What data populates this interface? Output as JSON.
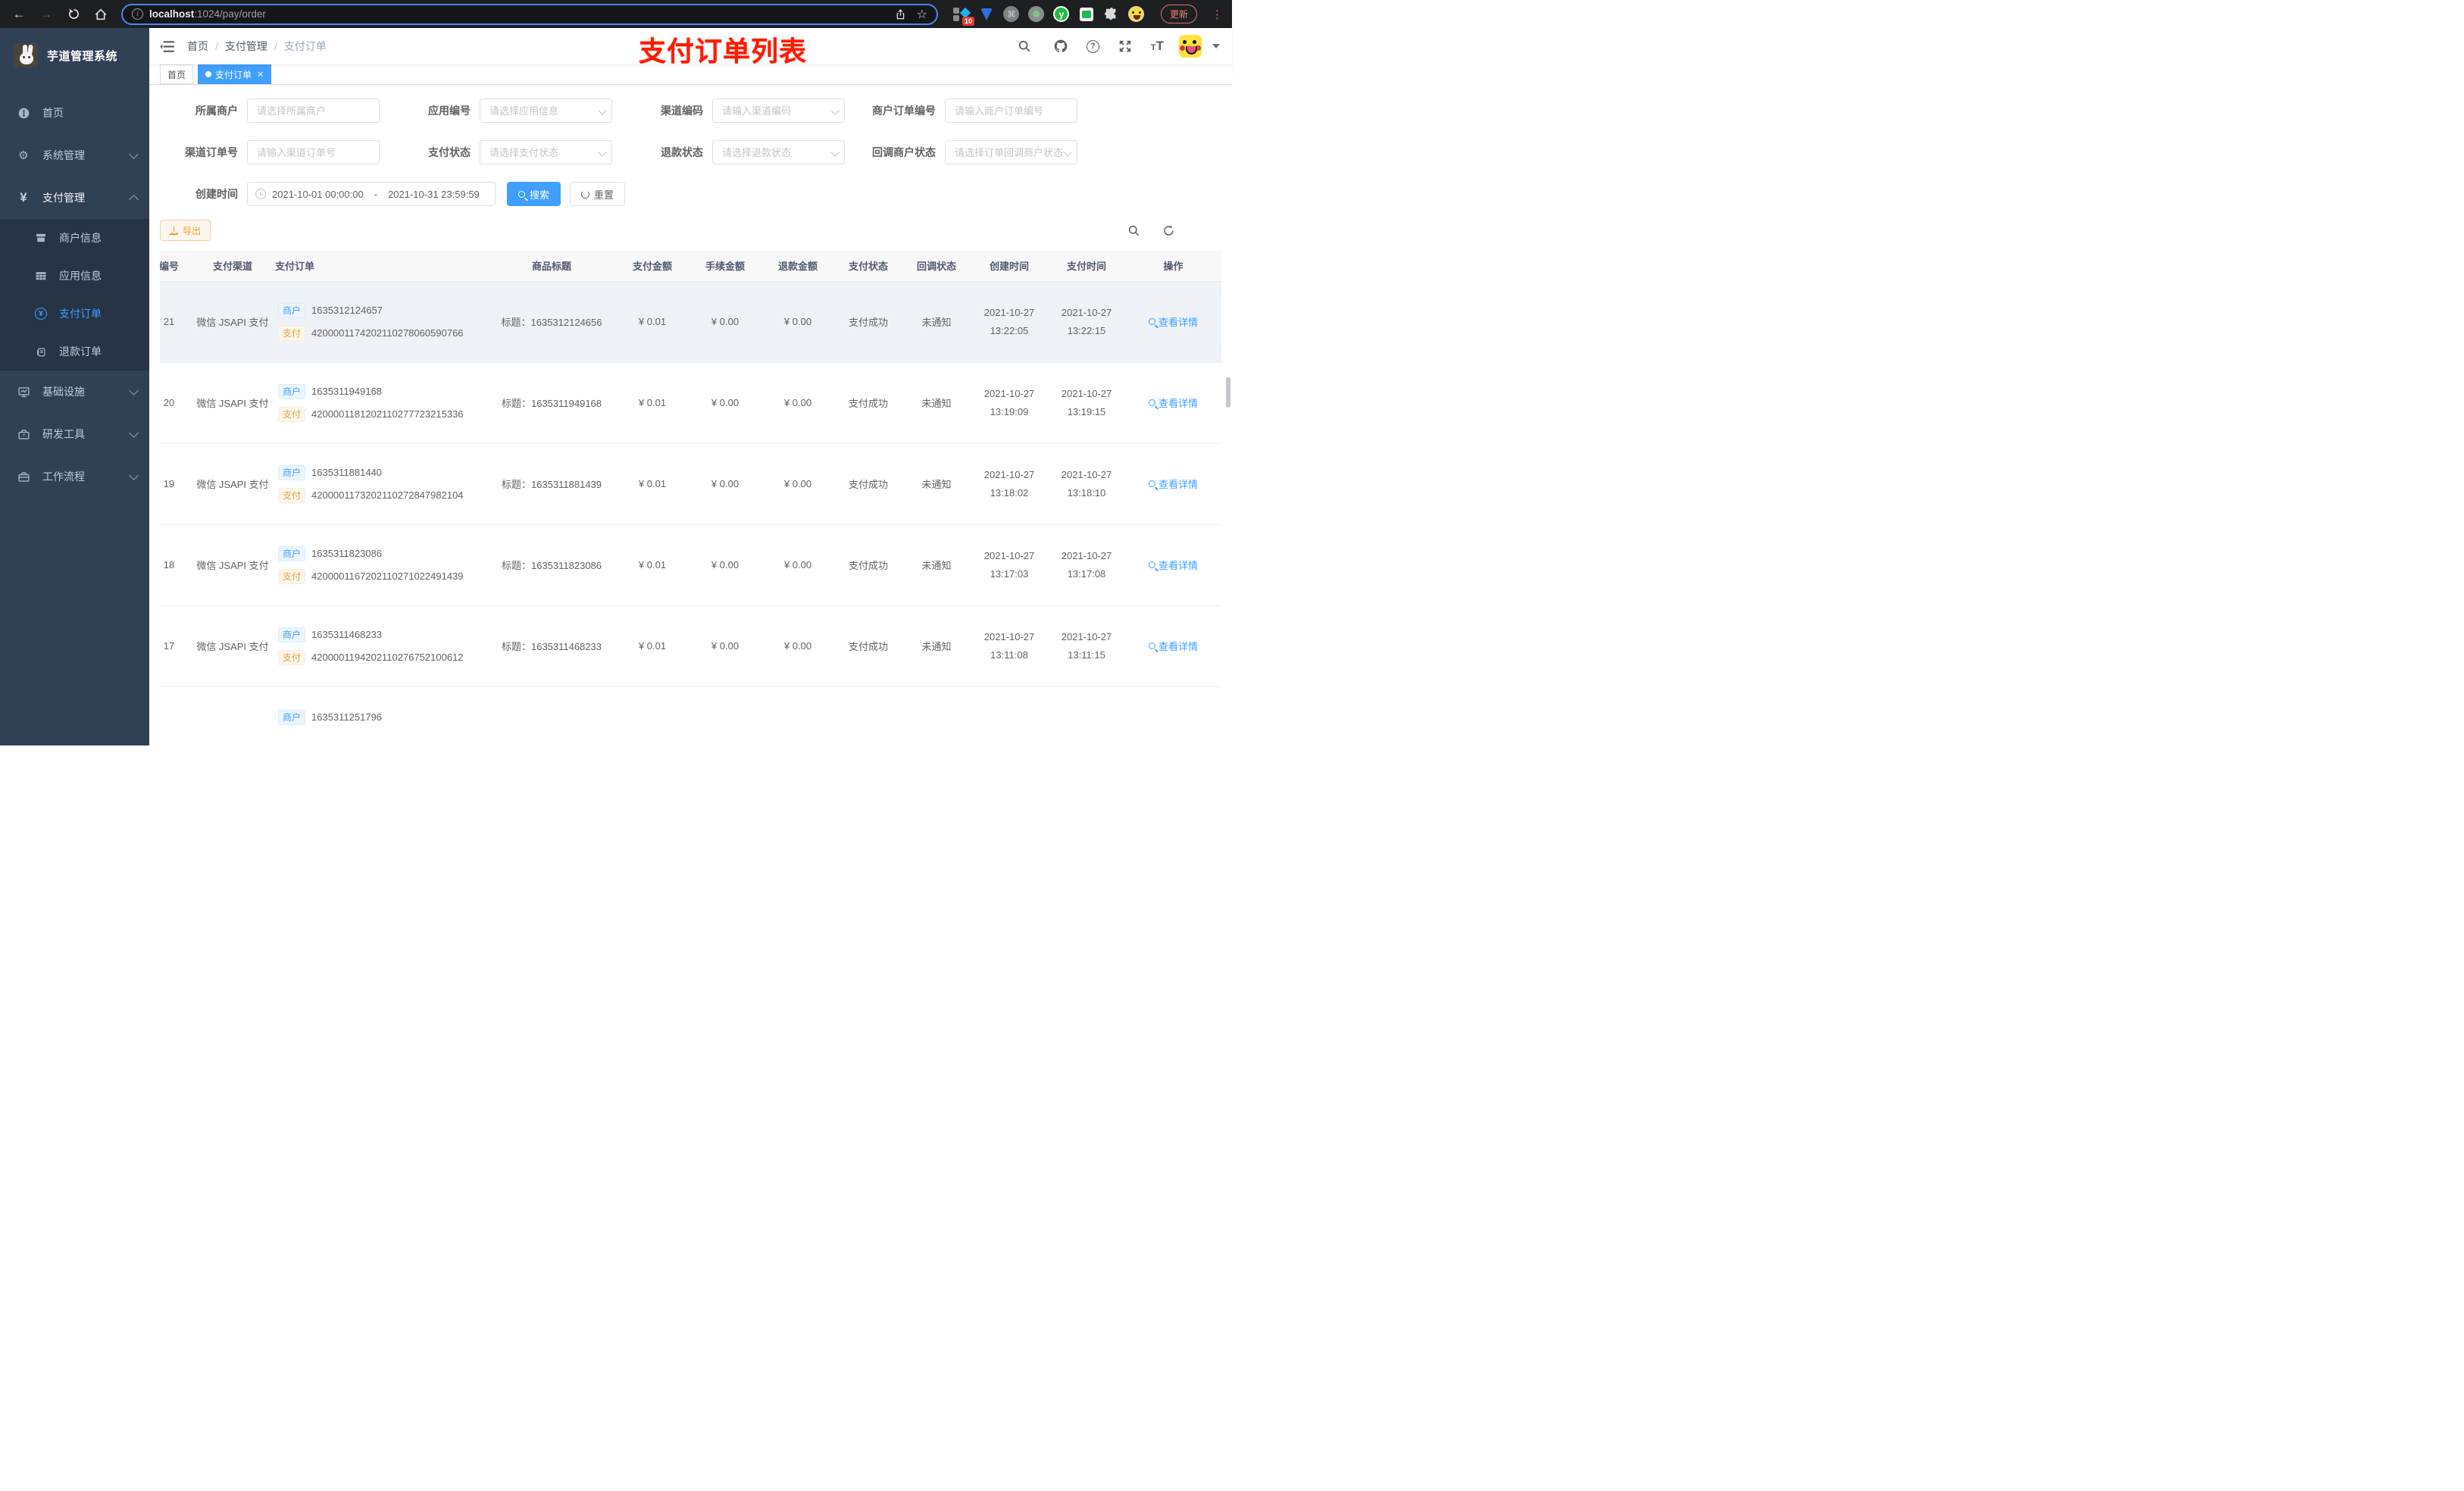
{
  "browser": {
    "url": {
      "host": "localhost",
      "rest": ":1024/pay/order"
    },
    "update_label": "更新",
    "extension_badge": "10"
  },
  "sidebar": {
    "logo_title": "芋道管理系统",
    "menu": {
      "home": "首页",
      "system": "系统管理",
      "payment": "支付管理",
      "infra": "基础设施",
      "devtools": "研发工具",
      "workflow": "工作流程"
    },
    "submenu": {
      "merchant": "商户信息",
      "app": "应用信息",
      "pay_order": "支付订单",
      "refund_order": "退款订单"
    }
  },
  "header": {
    "breadcrumb": [
      "首页",
      "支付管理",
      "支付订单"
    ],
    "annotation": "支付订单列表"
  },
  "tags_view": {
    "home": "首页",
    "active": "支付订单"
  },
  "filters": {
    "fields": [
      {
        "label": "所属商户",
        "placeholder": "请选择所属商户",
        "type": "input"
      },
      {
        "label": "应用编号",
        "placeholder": "请选择应用信息",
        "type": "select"
      },
      {
        "label": "渠道编码",
        "placeholder": "请输入渠道编码",
        "type": "select"
      },
      {
        "label": "商户订单编号",
        "placeholder": "请输入商户订单编号",
        "type": "input"
      },
      {
        "label": "渠道订单号",
        "placeholder": "请输入渠道订单号",
        "type": "input"
      },
      {
        "label": "支付状态",
        "placeholder": "请选择支付状态",
        "type": "select"
      },
      {
        "label": "退款状态",
        "placeholder": "请选择退款状态",
        "type": "select"
      },
      {
        "label": "回调商户状态",
        "placeholder": "请选择订单回调商户状态",
        "type": "select"
      }
    ],
    "date": {
      "label": "创建时间",
      "start": "2021-10-01 00:00:00",
      "separator": "-",
      "end": "2021-10-31 23:59:59"
    },
    "search_label": "搜索",
    "reset_label": "重置"
  },
  "toolbar": {
    "export_label": "导出"
  },
  "table": {
    "columns": [
      "编号",
      "支付渠道",
      "支付订单",
      "商品标题",
      "支付金额",
      "手续金额",
      "退款金额",
      "支付状态",
      "回调状态",
      "创建时间",
      "支付时间",
      "操作"
    ],
    "tag_merchant": "商户",
    "tag_pay": "支付",
    "title_prefix": "标题：",
    "action_label": "查看详情",
    "rows": [
      {
        "id": "21",
        "channel": "微信 JSAPI 支付",
        "merchant_no": "1635312124657",
        "pay_no": "4200001174202110278060590766",
        "title": "1635312124656",
        "amount": "¥ 0.01",
        "fee": "¥ 0.00",
        "refund": "¥ 0.00",
        "pay_status": "支付成功",
        "notify_status": "未通知",
        "create_date": "2021-10-27",
        "create_time": "13:22:05",
        "pay_date": "2021-10-27",
        "pay_time": "13:22:15",
        "highlight": true
      },
      {
        "id": "20",
        "channel": "微信 JSAPI 支付",
        "merchant_no": "1635311949168",
        "pay_no": "4200001181202110277723215336",
        "title": "1635311949168",
        "amount": "¥ 0.01",
        "fee": "¥ 0.00",
        "refund": "¥ 0.00",
        "pay_status": "支付成功",
        "notify_status": "未通知",
        "create_date": "2021-10-27",
        "create_time": "13:19:09",
        "pay_date": "2021-10-27",
        "pay_time": "13:19:15"
      },
      {
        "id": "19",
        "channel": "微信 JSAPI 支付",
        "merchant_no": "1635311881440",
        "pay_no": "4200001173202110272847982104",
        "title": "1635311881439",
        "amount": "¥ 0.01",
        "fee": "¥ 0.00",
        "refund": "¥ 0.00",
        "pay_status": "支付成功",
        "notify_status": "未通知",
        "create_date": "2021-10-27",
        "create_time": "13:18:02",
        "pay_date": "2021-10-27",
        "pay_time": "13:18:10"
      },
      {
        "id": "18",
        "channel": "微信 JSAPI 支付",
        "merchant_no": "1635311823086",
        "pay_no": "4200001167202110271022491439",
        "title": "1635311823086",
        "amount": "¥ 0.01",
        "fee": "¥ 0.00",
        "refund": "¥ 0.00",
        "pay_status": "支付成功",
        "notify_status": "未通知",
        "create_date": "2021-10-27",
        "create_time": "13:17:03",
        "pay_date": "2021-10-27",
        "pay_time": "13:17:08"
      },
      {
        "id": "17",
        "channel": "微信 JSAPI 支付",
        "merchant_no": "1635311468233",
        "pay_no": "4200001194202110276752100612",
        "title": "1635311468233",
        "amount": "¥ 0.01",
        "fee": "¥ 0.00",
        "refund": "¥ 0.00",
        "pay_status": "支付成功",
        "notify_status": "未通知",
        "create_date": "2021-10-27",
        "create_time": "13:11:08",
        "pay_date": "2021-10-27",
        "pay_time": "13:11:15"
      },
      {
        "merchant_no": "1635311251796",
        "partial": true
      }
    ]
  },
  "colors": {
    "primary": "#409eff",
    "warning": "#e6a23c",
    "sidebar_bg": "#304156",
    "annotation_red": "#ff1a00"
  }
}
